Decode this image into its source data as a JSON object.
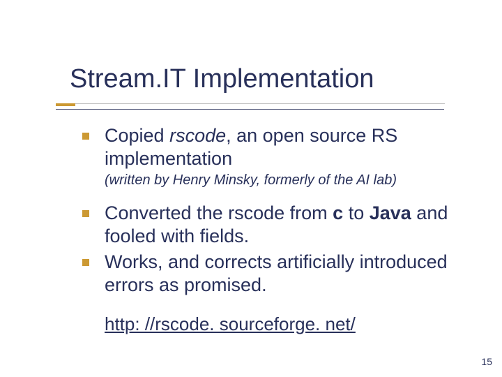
{
  "title": "Stream.IT Implementation",
  "bullets": [
    {
      "pre": "Copied ",
      "em": "rscode",
      "post": ", an open source RS implementation",
      "sub": "(written by Henry Minsky, formerly of the AI lab)"
    },
    {
      "pre": "Converted the rscode from ",
      "b1": "c",
      "mid": " to ",
      "b2": "Java",
      "post2": " and fooled with fields."
    },
    {
      "plain": "Works, and corrects artificially introduced errors as promised."
    }
  ],
  "link": "http: //rscode. sourceforge. net/",
  "pageNumber": "15",
  "underlineWidth": 557
}
